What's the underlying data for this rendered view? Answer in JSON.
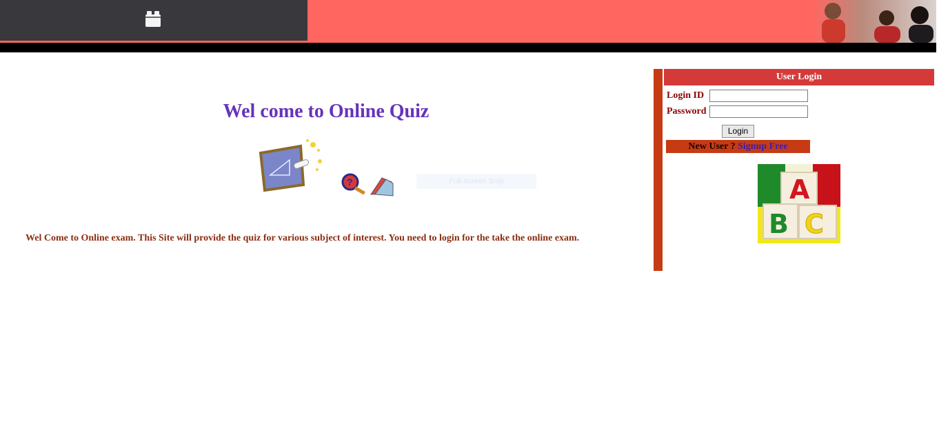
{
  "header": {
    "toolbar_icon": "box-icon",
    "banner_image": "people-photo"
  },
  "main": {
    "title": "Wel come to Online Quiz",
    "snip_hint": "Full-screen Snip",
    "intro": "Wel Come to Online exam. This Site will provide the quiz for various subject of interest. You need to login for the take the online exam."
  },
  "login": {
    "header": "User Login",
    "login_id_label": "Login ID",
    "login_id_value": "",
    "password_label": "Password",
    "password_value": "",
    "button_label": "Login",
    "new_user_text": "New User ?",
    "signup_text": "Signup Free"
  },
  "colors": {
    "header_coral": "#ff6660",
    "header_dark": "#39383d",
    "title_purple": "#6633bb",
    "text_brown": "#8b2e12",
    "panel_red": "#c63b14",
    "login_header": "#d43a3a"
  }
}
